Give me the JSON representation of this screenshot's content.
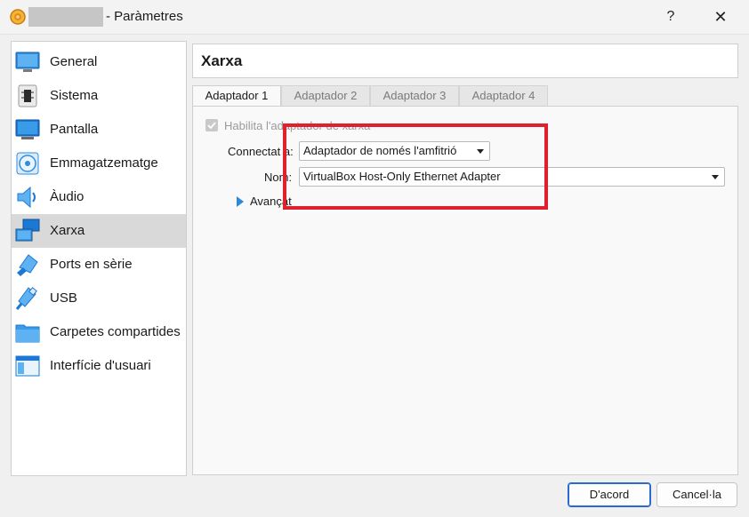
{
  "window": {
    "title": "- Paràmetres",
    "help_label": "?",
    "close_label": "✕"
  },
  "sidebar": {
    "items": [
      {
        "label": "General",
        "icon": "general-icon"
      },
      {
        "label": "Sistema",
        "icon": "system-chip-icon"
      },
      {
        "label": "Pantalla",
        "icon": "display-icon"
      },
      {
        "label": "Emmagatzematge",
        "icon": "storage-disk-icon"
      },
      {
        "label": "Àudio",
        "icon": "speaker-icon"
      },
      {
        "label": "Xarxa",
        "icon": "network-icon",
        "selected": true
      },
      {
        "label": "Ports en sèrie",
        "icon": "serial-port-icon"
      },
      {
        "label": "USB",
        "icon": "usb-icon"
      },
      {
        "label": "Carpetes compartides",
        "icon": "shared-folder-icon"
      },
      {
        "label": "Interfície d'usuari",
        "icon": "user-interface-icon"
      }
    ]
  },
  "page": {
    "title": "Xarxa"
  },
  "tabs": {
    "items": [
      {
        "label": "Adaptador 1",
        "active": true
      },
      {
        "label": "Adaptador 2"
      },
      {
        "label": "Adaptador 3"
      },
      {
        "label": "Adaptador 4"
      }
    ]
  },
  "adapter": {
    "enable_label": "Habilita l'adaptador de xarxa",
    "enabled": true,
    "attached_label": "Connectat a:",
    "attached_value": "Adaptador de només l'amfitrió",
    "name_label": "Nom:",
    "name_value": "VirtualBox Host-Only Ethernet Adapter",
    "advanced_label": "Avançat"
  },
  "buttons": {
    "ok_label": "D'acord",
    "cancel_label": "Cancel·la"
  },
  "colors": {
    "highlight": "#e0202c",
    "accent": "#2a6ad0",
    "selected_item": "#d9d9d9"
  }
}
